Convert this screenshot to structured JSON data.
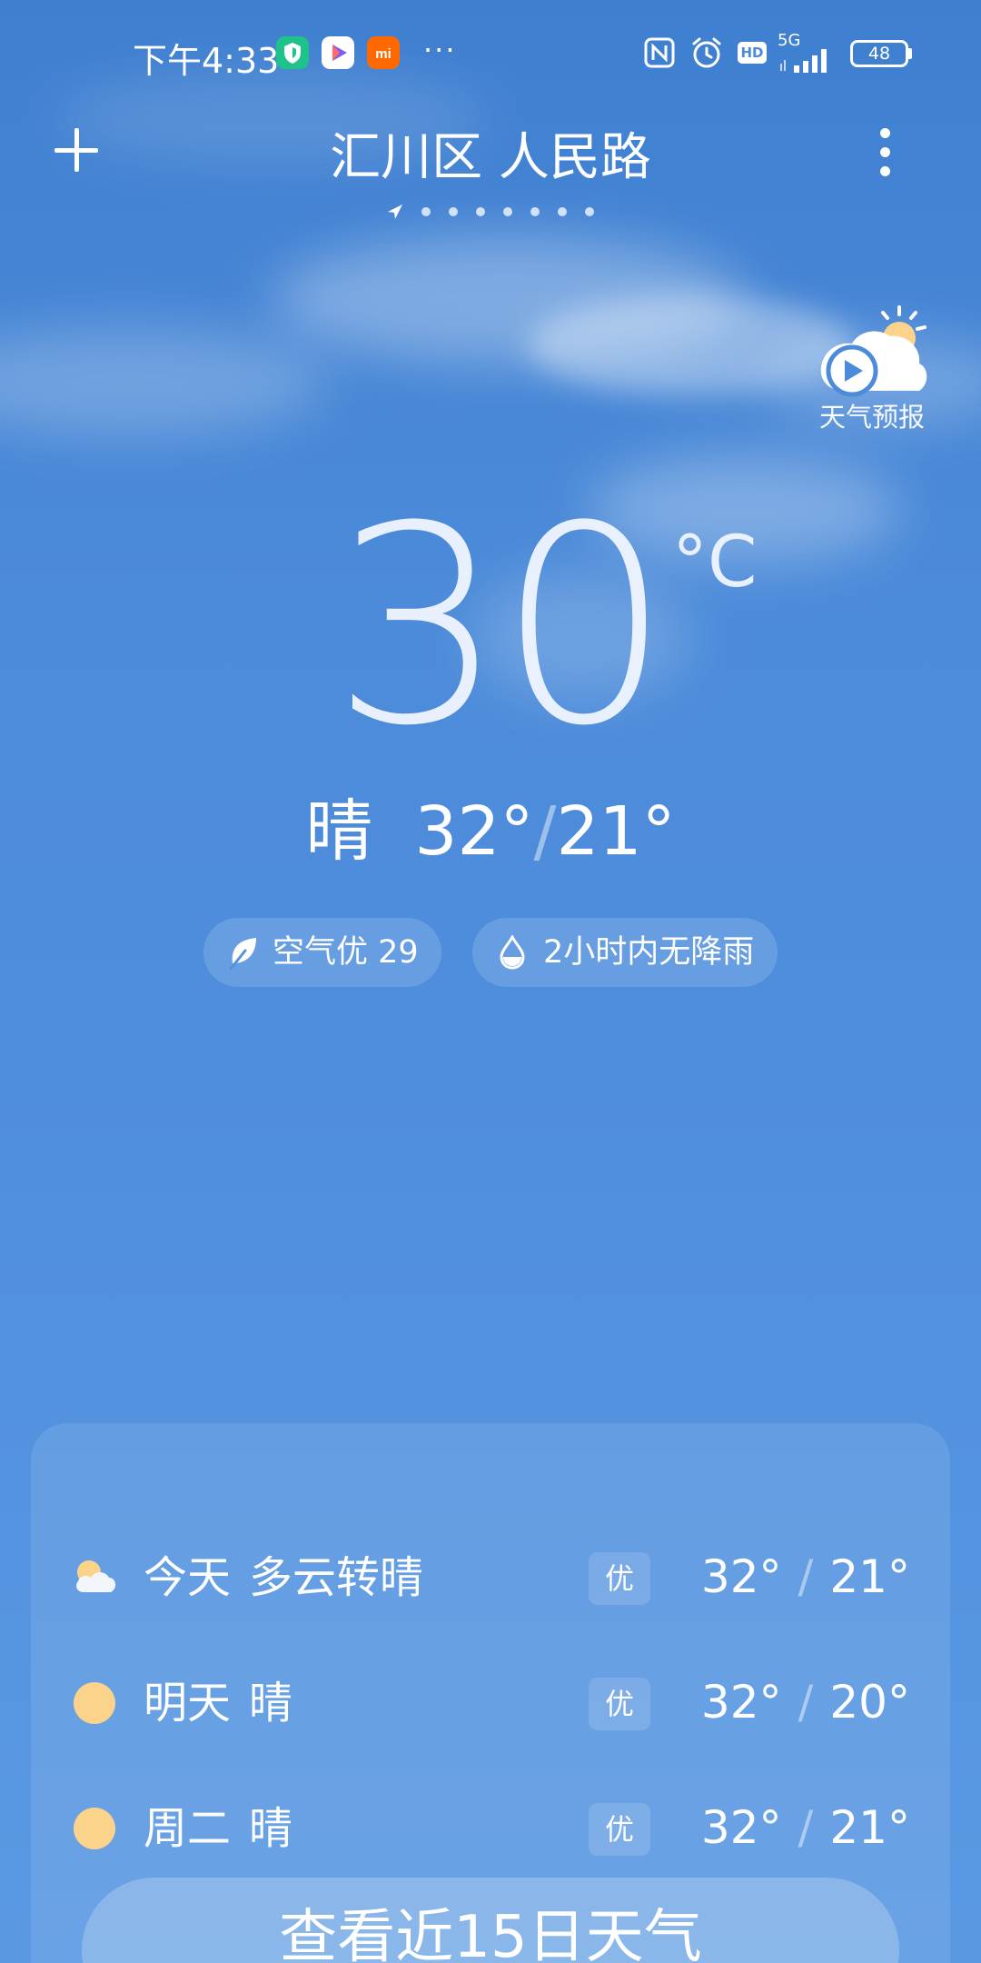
{
  "status_bar": {
    "time": "下午4:33",
    "more": "···",
    "hd": "HD",
    "network": "5G",
    "battery": "48"
  },
  "header": {
    "location": "汇川区 人民路"
  },
  "video_forecast": {
    "label": "天气预报"
  },
  "current": {
    "temperature": "30",
    "unit": "°C",
    "condition": "晴",
    "high": "32°",
    "separator": "/",
    "low": "21°"
  },
  "chips": {
    "air_quality": "空气优 29",
    "rain": "2小时内无降雨"
  },
  "forecast": [
    {
      "day": "今天",
      "condition": "多云转晴",
      "aqi": "优",
      "high": "32°",
      "low": "21°",
      "icon": "partly-cloudy-icon"
    },
    {
      "day": "明天",
      "condition": "晴",
      "aqi": "优",
      "high": "32°",
      "low": "20°",
      "icon": "sun-icon"
    },
    {
      "day": "周二",
      "condition": "晴",
      "aqi": "优",
      "high": "32°",
      "low": "21°",
      "icon": "sun-icon"
    }
  ],
  "forecast_separator": "/",
  "view15_button": {
    "label": "查看近15日天气"
  },
  "colors": {
    "sun": "#fbd38a",
    "cloud": "#f2f6fc",
    "sky": "#4c8bd9"
  }
}
